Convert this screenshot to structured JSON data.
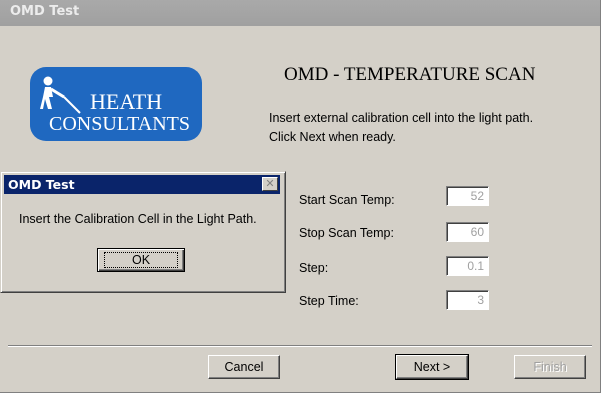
{
  "window": {
    "title": "OMD Test"
  },
  "logo": {
    "line1": "HEATH",
    "line2": "CONSULTANTS"
  },
  "wizard": {
    "heading": "OMD - TEMPERATURE SCAN",
    "instruction_line1": "Insert external calibration cell into the light path.",
    "instruction_line2": "Click Next when ready.",
    "fields": [
      {
        "label": "Start Scan Temp:",
        "value": "52"
      },
      {
        "label": "Stop Scan Temp:",
        "value": "60"
      },
      {
        "label": "Step:",
        "value": "0.1"
      },
      {
        "label": "Step Time:",
        "value": "3"
      }
    ],
    "buttons": {
      "cancel": "Cancel",
      "next": "Next >",
      "finish": "Finish"
    }
  },
  "dialog": {
    "title": "OMD Test",
    "message": "Insert the Calibration Cell in the Light Path.",
    "ok": "OK",
    "close_glyph": "✕"
  },
  "colors": {
    "face": "#d4d0c8",
    "title_inactive": "#a0a0a0",
    "title_active": "#0a246a",
    "logo_blue": "#1f68c0"
  }
}
